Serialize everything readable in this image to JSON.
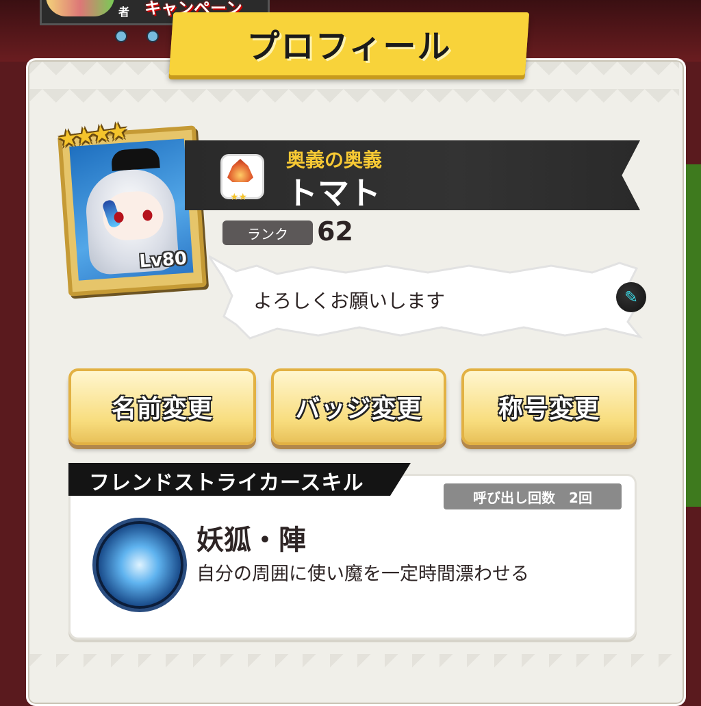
{
  "background_banner": {
    "small_text": "者",
    "campaign_text": "キャンペーン"
  },
  "header": {
    "title": "プロフィール"
  },
  "character_card": {
    "level": "Lv80",
    "stars": "★★★★"
  },
  "profile": {
    "subtitle": "奥義の奥義",
    "name": "トマト",
    "badge_stars": "★★",
    "rank_label": "ランク",
    "rank_value": "62",
    "message": "よろしくお願いします",
    "edit_icon": "pencil-icon"
  },
  "actions": {
    "change_name": "名前変更",
    "change_badge": "バッジ変更",
    "change_title": "称号変更"
  },
  "friend_skill": {
    "section_label": "フレンドストライカースキル",
    "call_count": "呼び出し回数　2回",
    "name": "妖狐・陣",
    "description": "自分の周囲に使い魔を一定時間漂わせる"
  },
  "colors": {
    "title_banner": "#f8d33a",
    "button_fill": "#f8dd7e",
    "name_band": "#2a2a2a",
    "subtitle": "#f7c934"
  }
}
